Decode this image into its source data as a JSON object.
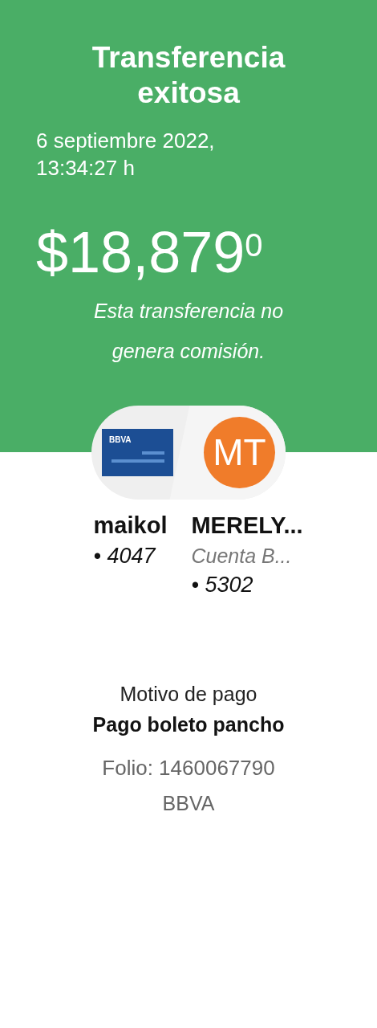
{
  "header": {
    "title": "Transferencia exitosa",
    "date": "6 septiembre 2022, 13:34:27 h",
    "amount": "$18,879$^{0}$",
    "note": "Esta transferencia no genera comisión."
  },
  "origin": {
    "card_brand": "BBVA",
    "name": "maikol",
    "account": "• 4047"
  },
  "destination": {
    "initials": "MT",
    "name": "MERELY...",
    "account_type": "Cuenta B...",
    "account": "• 5302"
  },
  "payment": {
    "label": "Motivo de pago",
    "reason": "Pago boleto pancho",
    "folio": "Folio: 1460067790",
    "bank": "BBVA"
  }
}
